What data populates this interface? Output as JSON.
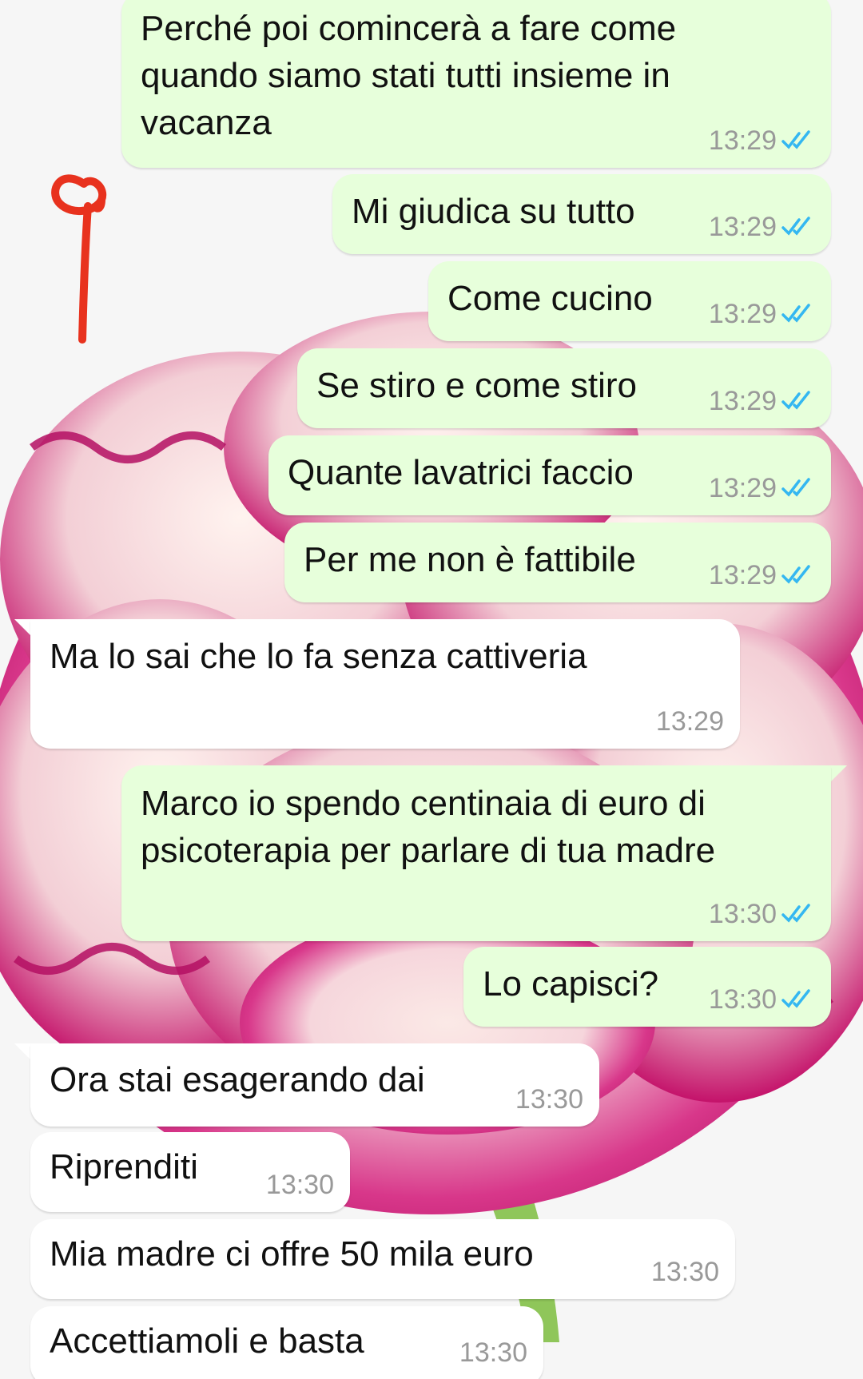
{
  "chat": {
    "messages": [
      {
        "direction": "out",
        "text": "Perché poi comincerà a fare come\nquando siamo stati tutti insieme in\nvacanza",
        "time": "13:29",
        "status": "read"
      },
      {
        "direction": "out",
        "text": "Mi giudica su tutto",
        "time": "13:29",
        "status": "read"
      },
      {
        "direction": "out",
        "text": "Come cucino",
        "time": "13:29",
        "status": "read"
      },
      {
        "direction": "out",
        "text": "Se stiro e come stiro",
        "time": "13:29",
        "status": "read"
      },
      {
        "direction": "out",
        "text": "Quante lavatrici faccio",
        "time": "13:29",
        "status": "read"
      },
      {
        "direction": "out",
        "text": "Per me non è fattibile",
        "time": "13:29",
        "status": "read"
      },
      {
        "direction": "in",
        "text": "Ma lo sai che lo fa senza cattiveria",
        "time": "13:29"
      },
      {
        "direction": "out",
        "text": "Marco io spendo centinaia di euro di\npsicoterapia per parlare di tua madre",
        "time": "13:30",
        "status": "read"
      },
      {
        "direction": "out",
        "text": "Lo capisci?",
        "time": "13:30",
        "status": "read"
      },
      {
        "direction": "in",
        "text": "Ora stai esagerando dai",
        "time": "13:30"
      },
      {
        "direction": "in",
        "text": "Riprenditi",
        "time": "13:30"
      },
      {
        "direction": "in",
        "text": "Mia madre ci offre 50 mila euro",
        "time": "13:30"
      },
      {
        "direction": "in",
        "text": "Accettiamoli e basta",
        "time": "13:30"
      }
    ]
  },
  "theme": {
    "outgoing_bubble": "#e7ffdb",
    "incoming_bubble": "#ffffff",
    "read_tick_color": "#34b7f1",
    "time_color": "#999999",
    "annotation_color": "#e8321e",
    "wallpaper_petal_color": "#c8156e"
  },
  "icons": {
    "read_receipt": "double-check-icon",
    "annotation": "hand-drawn-mark"
  }
}
